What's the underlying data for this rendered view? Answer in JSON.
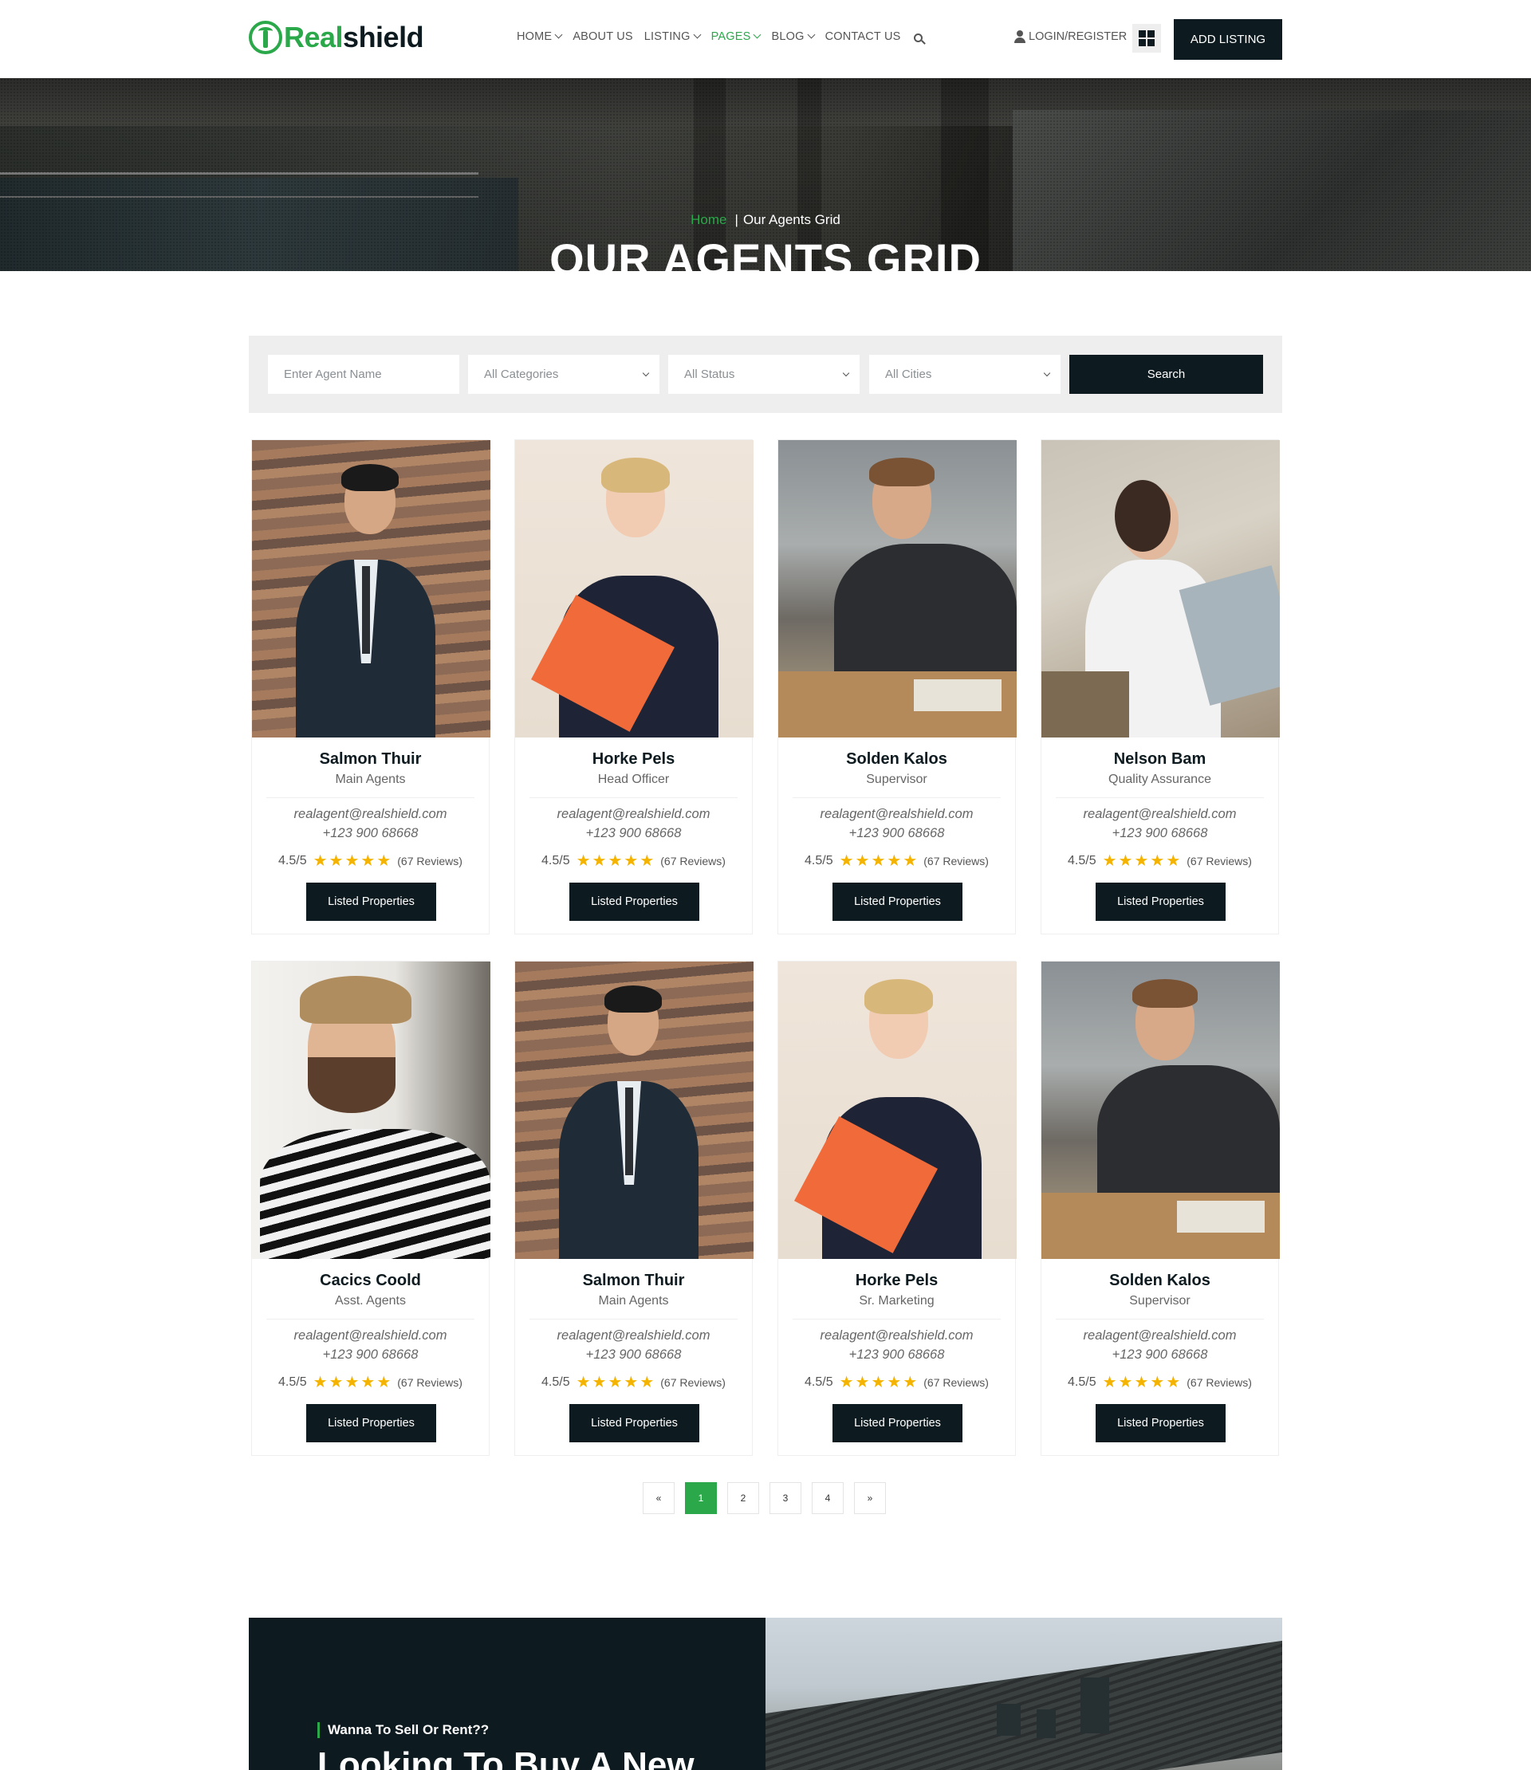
{
  "brand": {
    "part1": "Real",
    "part2": "shield"
  },
  "nav": [
    {
      "label": "HOME",
      "dropdown": true,
      "active": false
    },
    {
      "label": "ABOUT US",
      "dropdown": false,
      "active": false
    },
    {
      "label": "LISTING",
      "dropdown": true,
      "active": false
    },
    {
      "label": "PAGES",
      "dropdown": true,
      "active": true
    },
    {
      "label": "BLOG",
      "dropdown": true,
      "active": false
    },
    {
      "label": "CONTACT US",
      "dropdown": false,
      "active": false
    }
  ],
  "header": {
    "login_label": "LOGIN/REGISTER",
    "add_listing_label": "ADD LISTING"
  },
  "hero": {
    "breadcrumb_home": "Home",
    "breadcrumb_sep": "|",
    "breadcrumb_current": "Our Agents Grid",
    "title": "OUR AGENTS GRID"
  },
  "search": {
    "name_placeholder": "Enter Agent Name",
    "categories": "All Categories",
    "status": "All Status",
    "cities": "All Cities",
    "button": "Search"
  },
  "agents": [
    {
      "name": "Salmon Thuir",
      "role": "Main Agents",
      "email": "realagent@realshield.com",
      "phone": "+123 900 68668",
      "score": "4.5/5",
      "stars": 5,
      "reviews": "(67 Reviews)",
      "button": "Listed Properties"
    },
    {
      "name": "Horke Pels",
      "role": "Head Officer",
      "email": "realagent@realshield.com",
      "phone": "+123 900 68668",
      "score": "4.5/5",
      "stars": 5,
      "reviews": "(67 Reviews)",
      "button": "Listed Properties"
    },
    {
      "name": "Solden Kalos",
      "role": "Supervisor",
      "email": "realagent@realshield.com",
      "phone": "+123 900 68668",
      "score": "4.5/5",
      "stars": 5,
      "reviews": "(67 Reviews)",
      "button": "Listed Properties"
    },
    {
      "name": "Nelson Bam",
      "role": "Quality Assurance",
      "email": "realagent@realshield.com",
      "phone": "+123 900 68668",
      "score": "4.5/5",
      "stars": 5,
      "reviews": "(67 Reviews)",
      "button": "Listed Properties"
    },
    {
      "name": "Cacics Coold",
      "role": "Asst. Agents",
      "email": "realagent@realshield.com",
      "phone": "+123 900 68668",
      "score": "4.5/5",
      "stars": 5,
      "reviews": "(67 Reviews)",
      "button": "Listed Properties"
    },
    {
      "name": "Salmon Thuir",
      "role": "Main Agents",
      "email": "realagent@realshield.com",
      "phone": "+123 900 68668",
      "score": "4.5/5",
      "stars": 5,
      "reviews": "(67 Reviews)",
      "button": "Listed Properties"
    },
    {
      "name": "Horke Pels",
      "role": "Sr. Marketing",
      "email": "realagent@realshield.com",
      "phone": "+123 900 68668",
      "score": "4.5/5",
      "stars": 5,
      "reviews": "(67 Reviews)",
      "button": "Listed Properties"
    },
    {
      "name": "Solden Kalos",
      "role": "Supervisor",
      "email": "realagent@realshield.com",
      "phone": "+123 900 68668",
      "score": "4.5/5",
      "stars": 5,
      "reviews": "(67 Reviews)",
      "button": "Listed Properties"
    }
  ],
  "pagination": {
    "prev": "«",
    "pages": [
      "1",
      "2",
      "3",
      "4"
    ],
    "current": "1",
    "next": "»"
  },
  "cta": {
    "eyebrow": "Wanna To Sell Or Rent??",
    "title": "Looking To Buy A New"
  },
  "colors": {
    "accent": "#2aa84a",
    "dark": "#0d1b20",
    "star": "#f5b301"
  },
  "icons": [
    "logo-icon",
    "chevron-down-icon",
    "search-icon",
    "user-icon",
    "grid-view-icon",
    "star-icon",
    "select-caret-icon"
  ]
}
